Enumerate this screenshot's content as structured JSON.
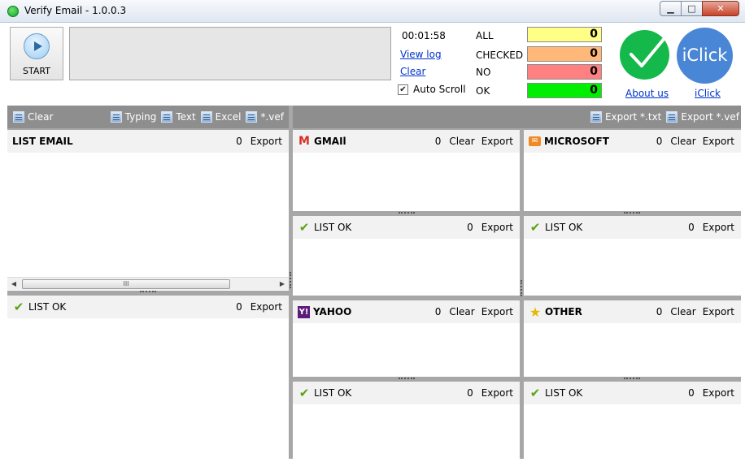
{
  "window": {
    "title": "Verify Email - 1.0.0.3",
    "minimize": "▁",
    "maximize": "□",
    "close": "✕"
  },
  "top": {
    "start_label": "START",
    "timer": "00:01:58",
    "view_log": "View log",
    "clear": "Clear",
    "auto_scroll": "Auto Scroll",
    "auto_scroll_checked": true,
    "stats": [
      {
        "label": "ALL",
        "value": "0",
        "color": "#ffff88"
      },
      {
        "label": "CHECKED",
        "value": "0",
        "color": "#ffb87a"
      },
      {
        "label": "NO",
        "value": "0",
        "color": "#ff8080"
      },
      {
        "label": "OK",
        "value": "0",
        "color": "#00ee00"
      }
    ],
    "about_us": "About us",
    "iclick_logo": "iClick",
    "iclick_link": "iClick"
  },
  "left_toolbar": {
    "clear": "Clear",
    "typing": "Typing",
    "text": "Text",
    "excel": "Excel",
    "vef": "*.vef"
  },
  "right_toolbar": {
    "export_txt": "Export *.txt",
    "export_vef": "Export *.vef"
  },
  "list_email": {
    "title": "LIST EMAIL",
    "count": "0",
    "export": "Export",
    "scroll_thumb": "III"
  },
  "list_ok_main": {
    "title": "LIST OK",
    "count": "0",
    "export": "Export"
  },
  "providers": {
    "gmail": {
      "title": "GMAIl",
      "count": "0",
      "clear": "Clear",
      "export": "Export",
      "icon": "gmail-icon"
    },
    "microsoft": {
      "title": "MICROSOFT",
      "count": "0",
      "clear": "Clear",
      "export": "Export",
      "icon": "microsoft-icon"
    },
    "yahoo": {
      "title": "YAHOO",
      "count": "0",
      "clear": "Clear",
      "export": "Export",
      "icon": "yahoo-icon"
    },
    "other": {
      "title": "OTHER",
      "count": "0",
      "clear": "Clear",
      "export": "Export",
      "icon": "star-icon"
    }
  },
  "list_ok": {
    "gmail": {
      "title": "LIST OK",
      "count": "0",
      "export": "Export"
    },
    "microsoft": {
      "title": "LIST OK",
      "count": "0",
      "export": "Export"
    },
    "yahoo": {
      "title": "LIST OK",
      "count": "0",
      "export": "Export"
    },
    "other": {
      "title": "LIST OK",
      "count": "0",
      "export": "Export"
    }
  }
}
